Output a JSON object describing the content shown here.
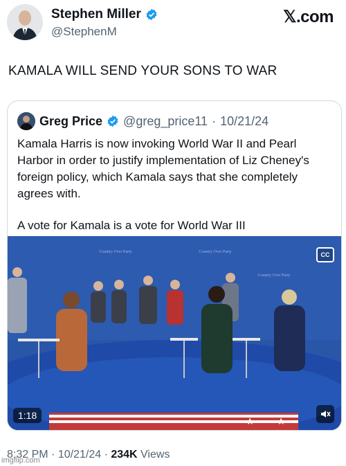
{
  "tweet": {
    "author_name": "Stephen Miller",
    "author_handle": "@StephenM",
    "site": "𝕏.com",
    "text": "KAMALA WILL SEND YOUR SONS TO WAR",
    "time": "8:32 PM",
    "date": "10/21/24",
    "views_count": "234K",
    "views_label": "Views"
  },
  "quote": {
    "author_name": "Greg Price",
    "author_handle": "@greg_price11",
    "date": "10/21/24",
    "paragraph1": "Kamala Harris is now invoking World War II and Pearl Harbor in order to justify implementation of Liz Cheney's foreign policy, which Kamala says that she completely agrees with.",
    "paragraph2": "A vote for Kamala is a vote for World War III",
    "video_time": "1:18",
    "backdrop_text": "Country Over Party"
  },
  "colors": {
    "verified": "#1d9bf0",
    "stage_blue": "#2a56a8",
    "floor_blue": "#1f4aa8"
  },
  "icons": [
    "verified-icon",
    "x-logo-icon",
    "captions-icon",
    "mute-icon"
  ],
  "watermark": "imgflip.com"
}
